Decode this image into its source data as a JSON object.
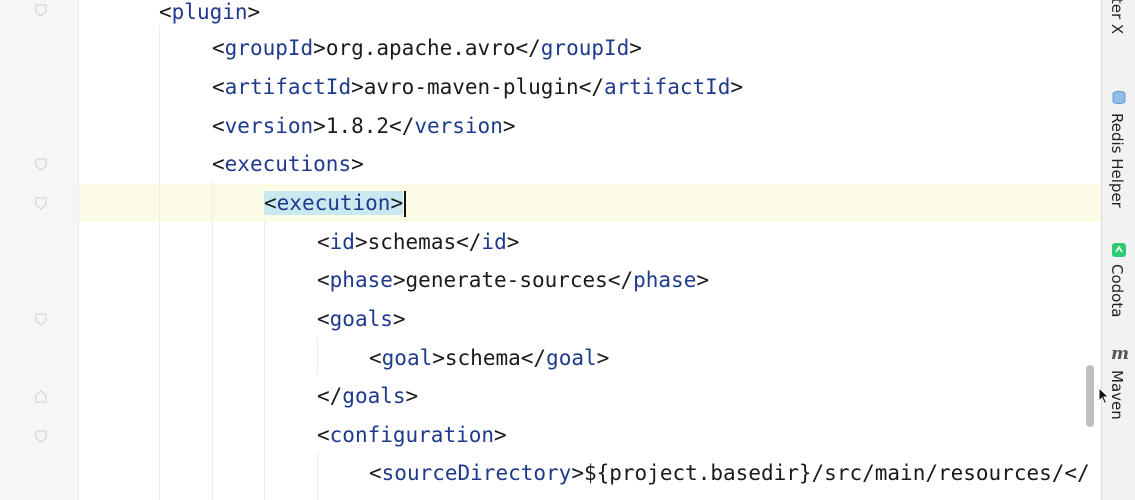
{
  "tool_window": {
    "top_partial_label": "pooter X",
    "items": [
      {
        "label": "Redis Helper",
        "icon": "redis-stack-icon",
        "color": "#6ea8d6"
      },
      {
        "label": "Codota",
        "icon": "codota-icon",
        "color": "#2ecc71"
      },
      {
        "label": "Maven",
        "icon": "maven-m-icon",
        "glyph": "m",
        "color": "#555555"
      }
    ]
  },
  "editor": {
    "current_line_color": "#fbfbe6",
    "matched_tag_color": "#c9e8f0",
    "tag_color": "#1e3a8c",
    "lines": [
      {
        "open": "<",
        "tag": "plugin",
        "close": ">",
        "text": "",
        "end_open": "",
        "end_tag": "",
        "end_close": ""
      },
      {
        "open": "<",
        "tag": "groupId",
        "close": ">",
        "text": "org.apache.avro",
        "end_open": "</",
        "end_tag": "groupId",
        "end_close": ">"
      },
      {
        "open": "<",
        "tag": "artifactId",
        "close": ">",
        "text": "avro-maven-plugin",
        "end_open": "</",
        "end_tag": "artifactId",
        "end_close": ">"
      },
      {
        "open": "<",
        "tag": "version",
        "close": ">",
        "text": "1.8.2",
        "end_open": "</",
        "end_tag": "version",
        "end_close": ">"
      },
      {
        "open": "<",
        "tag": "executions",
        "close": ">",
        "text": "",
        "end_open": "",
        "end_tag": "",
        "end_close": ""
      },
      {
        "open": "<",
        "tag": "execution",
        "close": ">",
        "text": "",
        "end_open": "",
        "end_tag": "",
        "end_close": ""
      },
      {
        "open": "<",
        "tag": "id",
        "close": ">",
        "text": "schemas",
        "end_open": "</",
        "end_tag": "id",
        "end_close": ">"
      },
      {
        "open": "<",
        "tag": "phase",
        "close": ">",
        "text": "generate-sources",
        "end_open": "</",
        "end_tag": "phase",
        "end_close": ">"
      },
      {
        "open": "<",
        "tag": "goals",
        "close": ">",
        "text": "",
        "end_open": "",
        "end_tag": "",
        "end_close": ""
      },
      {
        "open": "<",
        "tag": "goal",
        "close": ">",
        "text": "schema",
        "end_open": "</",
        "end_tag": "goal",
        "end_close": ">"
      },
      {
        "open": "</",
        "tag": "goals",
        "close": ">",
        "text": "",
        "end_open": "",
        "end_tag": "",
        "end_close": ""
      },
      {
        "open": "<",
        "tag": "configuration",
        "close": ">",
        "text": "",
        "end_open": "",
        "end_tag": "",
        "end_close": ""
      },
      {
        "open": "<",
        "tag": "sourceDirectory",
        "close": ">",
        "text": "${project.basedir}/src/main/resources/",
        "end_open": "</",
        "end_tag": "",
        "end_close": ""
      }
    ]
  }
}
